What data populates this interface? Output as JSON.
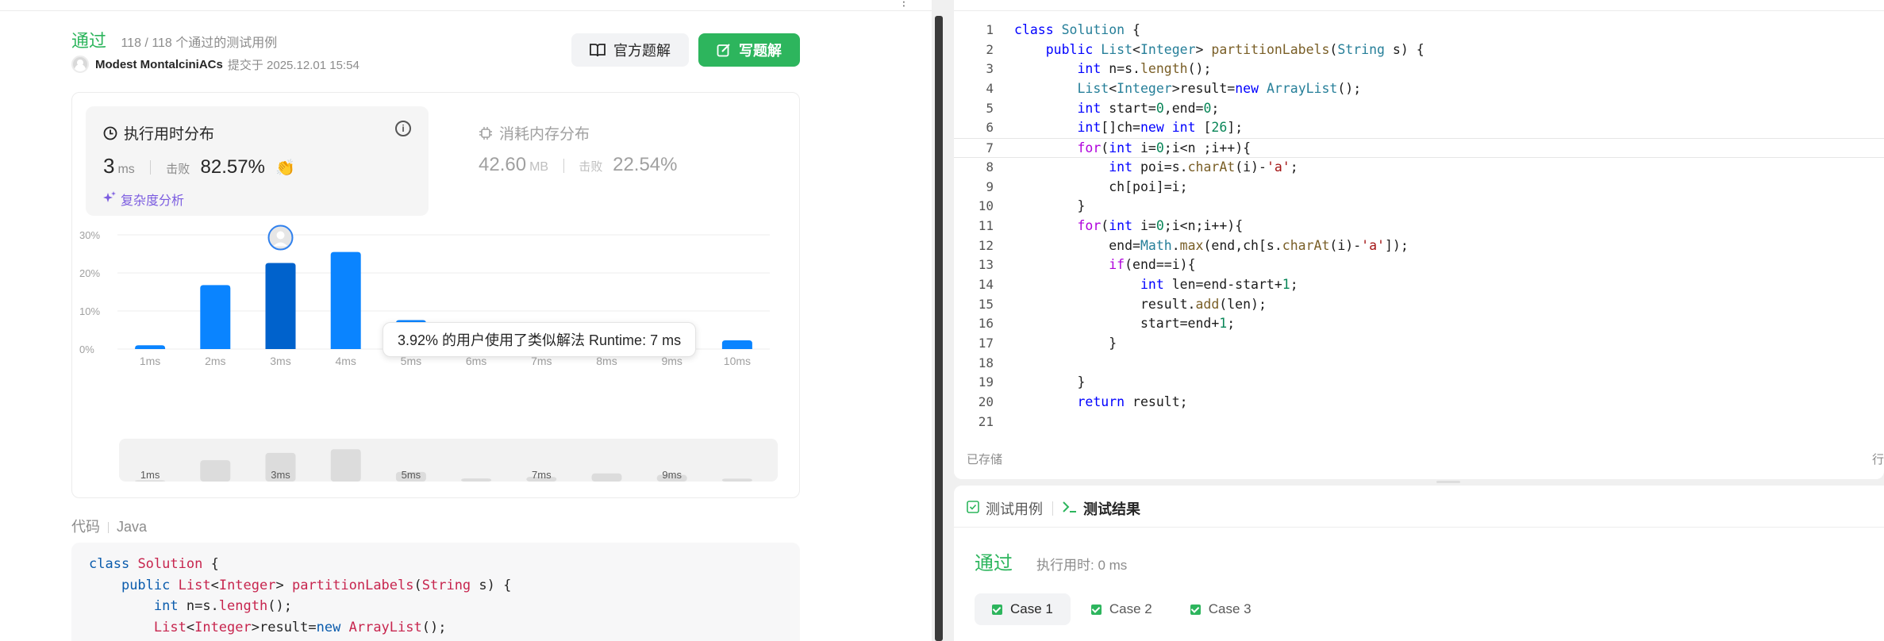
{
  "result": {
    "status": "通过",
    "cases_text": "118 / 118 个通过的测试用例",
    "user_name": "Modest MontalciniACs",
    "submit_time": "提交于 2025.12.01 15:54",
    "official_solution_label": "官方题解",
    "write_solution_label": "写题解"
  },
  "runtime": {
    "title": "执行用时分布",
    "value": "3",
    "unit": "ms",
    "beat_label": "击败",
    "beat_value": "82.57%",
    "complexity_label": "复杂度分析"
  },
  "memory": {
    "title": "消耗内存分布",
    "value": "42.60",
    "unit": "MB",
    "beat_label": "击败",
    "beat_value": "22.54%"
  },
  "chart_data": {
    "type": "bar",
    "categories": [
      "1ms",
      "2ms",
      "3ms",
      "4ms",
      "5ms",
      "6ms",
      "7ms",
      "8ms",
      "9ms",
      "10ms"
    ],
    "values": [
      1.0,
      16.8,
      22.6,
      25.5,
      7.6,
      2.4,
      3.7,
      6.4,
      5.3,
      2.3
    ],
    "highlight_index": 2,
    "ylim": [
      0,
      30
    ],
    "yticks": [
      "0%",
      "10%",
      "20%",
      "30%"
    ],
    "mini_labels": [
      "1ms",
      "3ms",
      "5ms",
      "7ms",
      "9ms"
    ],
    "tooltip": "3.92% 的用户使用了类似解法 Runtime: 7 ms",
    "colors": {
      "bar": "#0a84ff",
      "highlight": "#0062cc",
      "grid": "#ececec"
    }
  },
  "code_section": {
    "label": "代码",
    "language": "Java",
    "lines": [
      "class Solution {",
      "    public List<Integer> partitionLabels(String s) {",
      "        int n=s.length();",
      "        List<Integer>result=new ArrayList();"
    ]
  },
  "editor": {
    "lines": [
      "class Solution {",
      "    public List<Integer> partitionLabels(String s) {",
      "        int n=s.length();",
      "        List<Integer>result=new ArrayList();",
      "        int start=0,end=0;",
      "        int[]ch=new int [26];",
      "        for(int i=0;i<n ;i++){",
      "            int poi=s.charAt(i)-'a';",
      "            ch[poi]=i;",
      "        }",
      "        for(int i=0;i<n;i++){",
      "            end=Math.max(end,ch[s.charAt(i)-'a']);",
      "            if(end==i){",
      "                int len=end-start+1;",
      "                result.add(len);",
      "                start=end+1;",
      "            }",
      "",
      "        }",
      "        return result;",
      ""
    ],
    "active_line": 7,
    "saved_label": "已存储",
    "row_col_label": "行"
  },
  "test_panel": {
    "tab_cases": "测试用例",
    "tab_result": "测试结果",
    "status": "通过",
    "exec_time": "执行用时: 0 ms",
    "cases": [
      "Case 1",
      "Case 2",
      "Case 3"
    ]
  }
}
